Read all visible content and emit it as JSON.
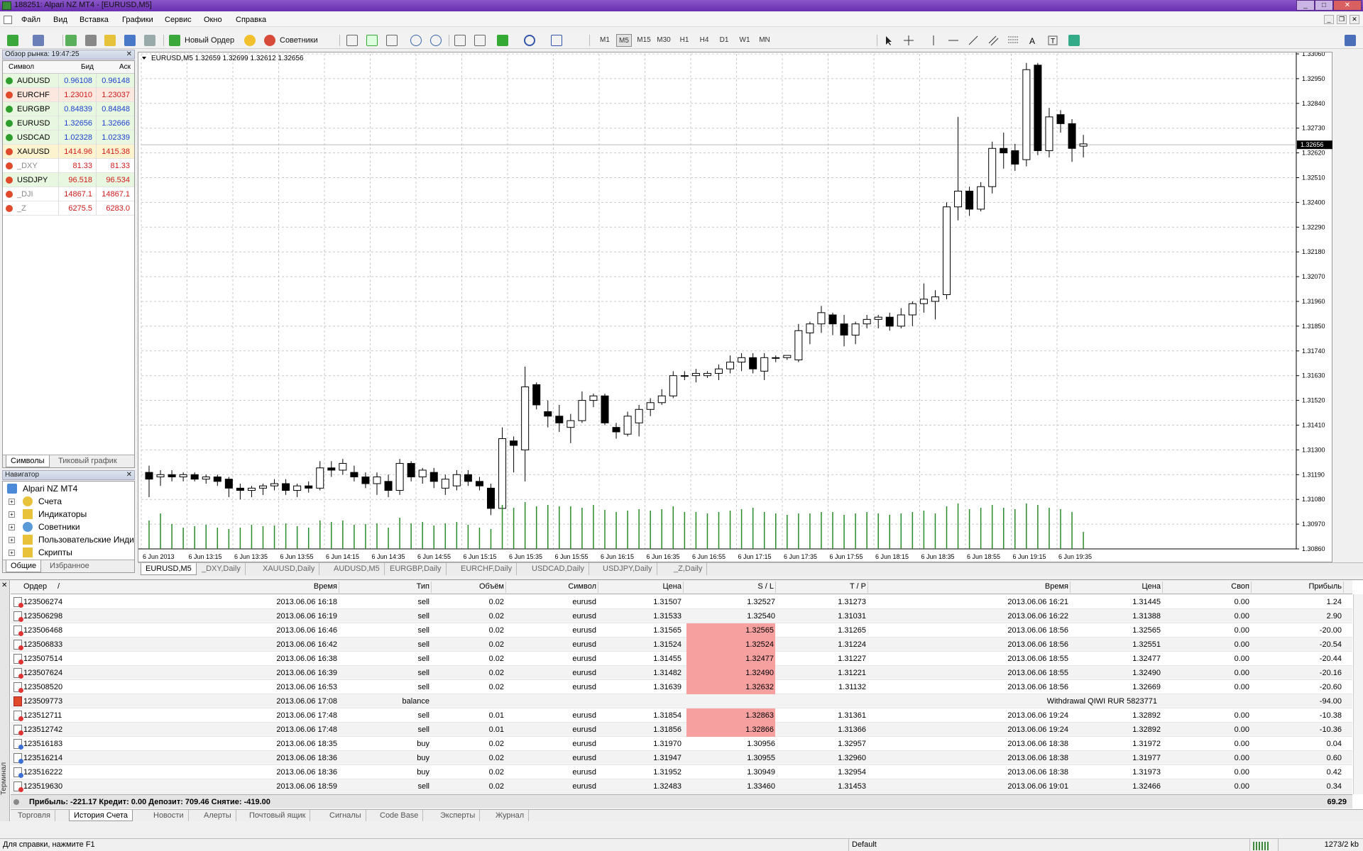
{
  "window": {
    "title": "188251: Alpari NZ MT4 - [EURUSD,M5]",
    "min": "_",
    "max": "□",
    "close": "✕"
  },
  "menu": [
    "Файл",
    "Вид",
    "Вставка",
    "Графики",
    "Сервис",
    "Окно",
    "Справка"
  ],
  "toolbar": {
    "new_order": "Новый Ордер",
    "experts": "Советники",
    "timeframes": [
      "M1",
      "M5",
      "M15",
      "M30",
      "H1",
      "H4",
      "D1",
      "W1",
      "MN"
    ],
    "active_tf": "M5"
  },
  "market_watch": {
    "title": "Обзор рынка: 19:47:25",
    "col_symbol": "Символ",
    "col_bid": "Бид",
    "col_ask": "Аск",
    "rows": [
      {
        "symbol": "AUDUSD",
        "bid": "0.96108",
        "ask": "0.96148",
        "dir": "up",
        "bg": "#e8f8e0",
        "color": "#1a3fd0"
      },
      {
        "symbol": "EURCHF",
        "bid": "1.23010",
        "ask": "1.23037",
        "dir": "dn",
        "bg": "#fde8e0",
        "color": "#d01a1a"
      },
      {
        "symbol": "EURGBP",
        "bid": "0.84839",
        "ask": "0.84848",
        "dir": "up",
        "bg": "#e8f8e0",
        "color": "#1a3fd0"
      },
      {
        "symbol": "EURUSD",
        "bid": "1.32656",
        "ask": "1.32666",
        "dir": "up",
        "bg": "#e8f8e0",
        "color": "#1a3fd0"
      },
      {
        "symbol": "USDCAD",
        "bid": "1.02328",
        "ask": "1.02339",
        "dir": "up",
        "bg": "#e8f8e0",
        "color": "#1a3fd0"
      },
      {
        "symbol": "XAUUSD",
        "bid": "1414.96",
        "ask": "1415.38",
        "dir": "dn",
        "bg": "#fdf3cf",
        "color": "#d01a1a"
      },
      {
        "symbol": "_DXY",
        "bid": "81.33",
        "ask": "81.33",
        "dir": "dn",
        "bg": "#ffffff",
        "color": "#d01a1a"
      },
      {
        "symbol": "USDJPY",
        "bid": "96.518",
        "ask": "96.534",
        "dir": "dn",
        "bg": "#e8f8e0",
        "color": "#d01a1a"
      },
      {
        "symbol": "_DJI",
        "bid": "14867.1",
        "ask": "14867.1",
        "dir": "dn",
        "bg": "#ffffff",
        "color": "#d01a1a"
      },
      {
        "symbol": "_Z",
        "bid": "6275.5",
        "ask": "6283.0",
        "dir": "dn",
        "bg": "#ffffff",
        "color": "#d01a1a"
      }
    ],
    "tabs": [
      "Символы",
      "Тиковый график"
    ]
  },
  "navigator": {
    "title": "Навигатор",
    "root": "Alpari NZ MT4",
    "items": [
      "Счета",
      "Индикаторы",
      "Советники",
      "Пользовательские Инди",
      "Скрипты"
    ],
    "tabs": [
      "Общие",
      "Избранное"
    ]
  },
  "chart": {
    "info": "EURUSD,M5  1.32659 1.32699 1.32612 1.32656",
    "price_labels": [
      "1.33060",
      "1.32950",
      "1.32840",
      "1.32730",
      "1.32620",
      "1.32510",
      "1.32400",
      "1.32290",
      "1.32180",
      "1.32070",
      "1.31960",
      "1.31850",
      "1.31740",
      "1.31630",
      "1.31520",
      "1.31410",
      "1.31300",
      "1.31190",
      "1.31080",
      "1.30970",
      "1.30860"
    ],
    "current_price": "1.32656",
    "time_labels": [
      "6 Jun 2013",
      "6 Jun 13:15",
      "6 Jun 13:35",
      "6 Jun 13:55",
      "6 Jun 14:15",
      "6 Jun 14:35",
      "6 Jun 14:55",
      "6 Jun 15:15",
      "6 Jun 15:35",
      "6 Jun 15:55",
      "6 Jun 16:15",
      "6 Jun 16:35",
      "6 Jun 16:55",
      "6 Jun 17:15",
      "6 Jun 17:35",
      "6 Jun 17:55",
      "6 Jun 18:15",
      "6 Jun 18:35",
      "6 Jun 18:55",
      "6 Jun 19:15",
      "6 Jun 19:35"
    ],
    "tabs": [
      "EURUSD,M5",
      "_DXY,Daily",
      "XAUUSD,Daily",
      "AUDUSD,M5",
      "EURGBP,Daily",
      "EURCHF,Daily",
      "USDCAD,Daily",
      "USDJPY,Daily",
      "_Z,Daily"
    ]
  },
  "chart_data": {
    "type": "candlestick",
    "ylim": [
      1.3086,
      1.3306
    ],
    "candles": [
      [
        1.312,
        1.3123,
        1.3109,
        1.3117
      ],
      [
        1.3118,
        1.3121,
        1.3114,
        1.3119
      ],
      [
        1.3119,
        1.3121,
        1.3116,
        1.3118
      ],
      [
        1.3118,
        1.312,
        1.3116,
        1.3119
      ],
      [
        1.3119,
        1.312,
        1.3116,
        1.3117
      ],
      [
        1.3117,
        1.3119,
        1.3115,
        1.3118
      ],
      [
        1.3118,
        1.3119,
        1.3114,
        1.3116
      ],
      [
        1.3117,
        1.3118,
        1.3109,
        1.3113
      ],
      [
        1.3113,
        1.3115,
        1.3108,
        1.3112
      ],
      [
        1.3112,
        1.3114,
        1.3109,
        1.3113
      ],
      [
        1.3113,
        1.3115,
        1.311,
        1.3114
      ],
      [
        1.3114,
        1.3117,
        1.3112,
        1.3115
      ],
      [
        1.3115,
        1.3117,
        1.311,
        1.3112
      ],
      [
        1.3112,
        1.3115,
        1.3109,
        1.3114
      ],
      [
        1.3114,
        1.3116,
        1.3111,
        1.3113
      ],
      [
        1.3113,
        1.3125,
        1.3112,
        1.3122
      ],
      [
        1.3122,
        1.3125,
        1.3118,
        1.3121
      ],
      [
        1.3121,
        1.3126,
        1.3119,
        1.3124
      ],
      [
        1.312,
        1.3123,
        1.3116,
        1.3118
      ],
      [
        1.3118,
        1.312,
        1.3113,
        1.3115
      ],
      [
        1.3115,
        1.312,
        1.311,
        1.3118
      ],
      [
        1.3116,
        1.3119,
        1.3109,
        1.3112
      ],
      [
        1.3112,
        1.3126,
        1.311,
        1.3124
      ],
      [
        1.3124,
        1.3125,
        1.3116,
        1.3118
      ],
      [
        1.3118,
        1.3122,
        1.3115,
        1.3121
      ],
      [
        1.312,
        1.3122,
        1.3113,
        1.3116
      ],
      [
        1.3113,
        1.3119,
        1.311,
        1.3117
      ],
      [
        1.3114,
        1.3121,
        1.3112,
        1.3119
      ],
      [
        1.3119,
        1.3121,
        1.3114,
        1.3116
      ],
      [
        1.3116,
        1.3118,
        1.3112,
        1.3114
      ],
      [
        1.3113,
        1.3115,
        1.3101,
        1.3104
      ],
      [
        1.3104,
        1.314,
        1.3102,
        1.3135
      ],
      [
        1.3134,
        1.3136,
        1.312,
        1.3132
      ],
      [
        1.313,
        1.3167,
        1.3116,
        1.3158
      ],
      [
        1.3159,
        1.316,
        1.3148,
        1.315
      ],
      [
        1.3147,
        1.3152,
        1.314,
        1.3145
      ],
      [
        1.3145,
        1.315,
        1.3138,
        1.3142
      ],
      [
        1.314,
        1.3146,
        1.3133,
        1.3143
      ],
      [
        1.3143,
        1.3156,
        1.3142,
        1.3152
      ],
      [
        1.3152,
        1.3155,
        1.3149,
        1.3154
      ],
      [
        1.3154,
        1.3155,
        1.3141,
        1.3142
      ],
      [
        1.314,
        1.3142,
        1.3135,
        1.3138
      ],
      [
        1.3137,
        1.3147,
        1.3136,
        1.3145
      ],
      [
        1.3142,
        1.315,
        1.3136,
        1.3148
      ],
      [
        1.3148,
        1.3153,
        1.3145,
        1.3151
      ],
      [
        1.3151,
        1.3157,
        1.315,
        1.3154
      ],
      [
        1.3154,
        1.3165,
        1.3153,
        1.3163
      ],
      [
        1.3163,
        1.3165,
        1.3161,
        1.3163
      ],
      [
        1.3163,
        1.3166,
        1.316,
        1.3164
      ],
      [
        1.3163,
        1.3165,
        1.3162,
        1.3164
      ],
      [
        1.3164,
        1.3168,
        1.3161,
        1.3166
      ],
      [
        1.3166,
        1.3172,
        1.3164,
        1.3169
      ],
      [
        1.3169,
        1.3173,
        1.3165,
        1.3171
      ],
      [
        1.3171,
        1.3173,
        1.3164,
        1.3166
      ],
      [
        1.3165,
        1.3173,
        1.3161,
        1.3171
      ],
      [
        1.3171,
        1.3172,
        1.3169,
        1.3171
      ],
      [
        1.3171,
        1.3172,
        1.317,
        1.3172
      ],
      [
        1.317,
        1.3186,
        1.3169,
        1.3183
      ],
      [
        1.3182,
        1.3187,
        1.3177,
        1.3186
      ],
      [
        1.3186,
        1.3194,
        1.3182,
        1.3191
      ],
      [
        1.319,
        1.3191,
        1.3181,
        1.3186
      ],
      [
        1.3186,
        1.319,
        1.3176,
        1.3181
      ],
      [
        1.3181,
        1.3187,
        1.3177,
        1.3186
      ],
      [
        1.3186,
        1.319,
        1.3184,
        1.3188
      ],
      [
        1.3188,
        1.319,
        1.3184,
        1.3189
      ],
      [
        1.3189,
        1.3191,
        1.3183,
        1.3185
      ],
      [
        1.3185,
        1.3193,
        1.3184,
        1.319
      ],
      [
        1.319,
        1.3196,
        1.3185,
        1.3195
      ],
      [
        1.3195,
        1.3204,
        1.3191,
        1.3197
      ],
      [
        1.3196,
        1.3201,
        1.3188,
        1.3198
      ],
      [
        1.3199,
        1.324,
        1.3197,
        1.3238
      ],
      [
        1.3238,
        1.3278,
        1.3232,
        1.3245
      ],
      [
        1.3245,
        1.3247,
        1.3234,
        1.3237
      ],
      [
        1.3237,
        1.3249,
        1.3236,
        1.3247
      ],
      [
        1.3247,
        1.3267,
        1.3244,
        1.3264
      ],
      [
        1.3264,
        1.3271,
        1.3255,
        1.3262
      ],
      [
        1.3263,
        1.3266,
        1.3254,
        1.3257
      ],
      [
        1.3259,
        1.3302,
        1.3256,
        1.3299
      ],
      [
        1.3301,
        1.3302,
        1.3261,
        1.3263
      ],
      [
        1.3263,
        1.3282,
        1.326,
        1.3278
      ],
      [
        1.3279,
        1.3281,
        1.3271,
        1.3275
      ],
      [
        1.3275,
        1.3277,
        1.3258,
        1.3264
      ],
      [
        1.3265,
        1.327,
        1.326,
        1.3266
      ]
    ],
    "volumes": [
      40,
      50,
      35,
      30,
      32,
      34,
      30,
      28,
      30,
      34,
      32,
      33,
      36,
      32,
      30,
      40,
      38,
      40,
      34,
      35,
      36,
      30,
      44,
      36,
      38,
      33,
      36,
      38,
      34,
      30,
      28,
      62,
      58,
      66,
      60,
      62,
      60,
      60,
      58,
      62,
      55,
      52,
      54,
      56,
      54,
      56,
      60,
      52,
      52,
      50,
      52,
      54,
      56,
      58,
      52,
      50,
      48,
      50,
      50,
      52,
      52,
      48,
      50,
      52,
      50,
      48,
      50,
      52,
      54,
      50,
      60,
      64,
      56,
      58,
      62,
      58,
      56,
      64,
      62,
      58,
      56,
      52,
      24
    ]
  },
  "history": {
    "columns": [
      "Ордер",
      "/",
      "Время",
      "Тип",
      "Объём",
      "Символ",
      "Цена",
      "S / L",
      "T / P",
      "Время",
      "Цена",
      "Своп",
      "Прибыль"
    ],
    "rows": [
      {
        "order": "123506274",
        "time": "2013.06.06 16:18",
        "type": "sell",
        "vol": "0.02",
        "sym": "eurusd",
        "price": "1.31507",
        "sl": "1.32527",
        "tp": "1.31273",
        "ctime": "2013.06.06 16:21",
        "cprice": "1.31445",
        "swap": "0.00",
        "profit": "1.24",
        "hl": false,
        "kind": "sell"
      },
      {
        "order": "123506298",
        "time": "2013.06.06 16:19",
        "type": "sell",
        "vol": "0.02",
        "sym": "eurusd",
        "price": "1.31533",
        "sl": "1.32540",
        "tp": "1.31031",
        "ctime": "2013.06.06 16:22",
        "cprice": "1.31388",
        "swap": "0.00",
        "profit": "2.90",
        "hl": false,
        "kind": "sell"
      },
      {
        "order": "123506468",
        "time": "2013.06.06 16:46",
        "type": "sell",
        "vol": "0.02",
        "sym": "eurusd",
        "price": "1.31565",
        "sl": "1.32565",
        "tp": "1.31265",
        "ctime": "2013.06.06 18:56",
        "cprice": "1.32565",
        "swap": "0.00",
        "profit": "-20.00",
        "hl": true,
        "kind": "sell"
      },
      {
        "order": "123506833",
        "time": "2013.06.06 16:42",
        "type": "sell",
        "vol": "0.02",
        "sym": "eurusd",
        "price": "1.31524",
        "sl": "1.32524",
        "tp": "1.31224",
        "ctime": "2013.06.06 18:56",
        "cprice": "1.32551",
        "swap": "0.00",
        "profit": "-20.54",
        "hl": true,
        "kind": "sell"
      },
      {
        "order": "123507514",
        "time": "2013.06.06 16:38",
        "type": "sell",
        "vol": "0.02",
        "sym": "eurusd",
        "price": "1.31455",
        "sl": "1.32477",
        "tp": "1.31227",
        "ctime": "2013.06.06 18:55",
        "cprice": "1.32477",
        "swap": "0.00",
        "profit": "-20.44",
        "hl": true,
        "kind": "sell"
      },
      {
        "order": "123507624",
        "time": "2013.06.06 16:39",
        "type": "sell",
        "vol": "0.02",
        "sym": "eurusd",
        "price": "1.31482",
        "sl": "1.32490",
        "tp": "1.31221",
        "ctime": "2013.06.06 18:55",
        "cprice": "1.32490",
        "swap": "0.00",
        "profit": "-20.16",
        "hl": true,
        "kind": "sell"
      },
      {
        "order": "123508520",
        "time": "2013.06.06 16:53",
        "type": "sell",
        "vol": "0.02",
        "sym": "eurusd",
        "price": "1.31639",
        "sl": "1.32632",
        "tp": "1.31132",
        "ctime": "2013.06.06 18:56",
        "cprice": "1.32669",
        "swap": "0.00",
        "profit": "-20.60",
        "hl": true,
        "kind": "sell"
      },
      {
        "order": "123509773",
        "time": "2013.06.06 17:08",
        "type": "balance",
        "vol": "",
        "sym": "",
        "price": "",
        "sl": "",
        "tp": "",
        "ctime": "",
        "cprice": "Withdrawal QIWI RUR 5823771",
        "swap": "",
        "profit": "-94.00",
        "hl": false,
        "kind": "bal"
      },
      {
        "order": "123512711",
        "time": "2013.06.06 17:48",
        "type": "sell",
        "vol": "0.01",
        "sym": "eurusd",
        "price": "1.31854",
        "sl": "1.32863",
        "tp": "1.31361",
        "ctime": "2013.06.06 19:24",
        "cprice": "1.32892",
        "swap": "0.00",
        "profit": "-10.38",
        "hl": true,
        "kind": "sell"
      },
      {
        "order": "123512742",
        "time": "2013.06.06 17:48",
        "type": "sell",
        "vol": "0.01",
        "sym": "eurusd",
        "price": "1.31856",
        "sl": "1.32866",
        "tp": "1.31366",
        "ctime": "2013.06.06 19:24",
        "cprice": "1.32892",
        "swap": "0.00",
        "profit": "-10.36",
        "hl": true,
        "kind": "sell"
      },
      {
        "order": "123516183",
        "time": "2013.06.06 18:35",
        "type": "buy",
        "vol": "0.02",
        "sym": "eurusd",
        "price": "1.31970",
        "sl": "1.30956",
        "tp": "1.32957",
        "ctime": "2013.06.06 18:38",
        "cprice": "1.31972",
        "swap": "0.00",
        "profit": "0.04",
        "hl": false,
        "kind": "buy"
      },
      {
        "order": "123516214",
        "time": "2013.06.06 18:36",
        "type": "buy",
        "vol": "0.02",
        "sym": "eurusd",
        "price": "1.31947",
        "sl": "1.30955",
        "tp": "1.32960",
        "ctime": "2013.06.06 18:38",
        "cprice": "1.31977",
        "swap": "0.00",
        "profit": "0.60",
        "hl": false,
        "kind": "buy"
      },
      {
        "order": "123516222",
        "time": "2013.06.06 18:36",
        "type": "buy",
        "vol": "0.02",
        "sym": "eurusd",
        "price": "1.31952",
        "sl": "1.30949",
        "tp": "1.32954",
        "ctime": "2013.06.06 18:38",
        "cprice": "1.31973",
        "swap": "0.00",
        "profit": "0.42",
        "hl": false,
        "kind": "buy"
      },
      {
        "order": "123519630",
        "time": "2013.06.06 18:59",
        "type": "sell",
        "vol": "0.02",
        "sym": "eurusd",
        "price": "1.32483",
        "sl": "1.33460",
        "tp": "1.31453",
        "ctime": "2013.06.06 19:01",
        "cprice": "1.32466",
        "swap": "0.00",
        "profit": "0.34",
        "hl": false,
        "kind": "sell"
      }
    ],
    "summary": "Прибыль: -221.17  Кредит: 0.00  Депозит: 709.46  Снятие: -419.00",
    "summary_total": "69.29"
  },
  "terminal": {
    "side_label": "Терминал",
    "tabs": [
      "Торговля",
      "История Счета",
      "Новости",
      "Алерты",
      "Почтовый ящик",
      "Сигналы",
      "Code Base",
      "Эксперты",
      "Журнал"
    ],
    "active_tab": "История Счета"
  },
  "status": {
    "help": "Для справки, нажмите F1",
    "profile": "Default",
    "traffic": "1273/2 kb"
  }
}
